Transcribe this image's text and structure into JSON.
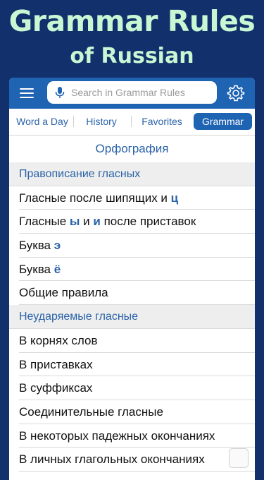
{
  "promo": {
    "title": "Grammar Rules",
    "subtitle": "of Russian"
  },
  "colors": {
    "background": "#12306b",
    "promo_text": "#c7f7d3",
    "navbar": "#1f63b3",
    "accent_text": "#2a63a8",
    "header_row": "#eeeeee"
  },
  "navbar": {
    "menu_icon": "hamburger-menu-icon",
    "mic_icon": "microphone-icon",
    "search_placeholder": "Search in Grammar Rules",
    "search_value": "",
    "settings_icon": "gear-icon"
  },
  "tabs": [
    {
      "label": "Word a Day",
      "active": false
    },
    {
      "label": "History",
      "active": false
    },
    {
      "label": "Favorites",
      "active": false
    },
    {
      "label": "Grammar",
      "active": true
    }
  ],
  "section_title": "Орфография",
  "rows": [
    {
      "type": "header",
      "parts": [
        {
          "t": "Правописание гласных"
        }
      ]
    },
    {
      "type": "item",
      "parts": [
        {
          "t": "Гласные после шипящих и "
        },
        {
          "t": "ц",
          "hl": true
        }
      ]
    },
    {
      "type": "item",
      "parts": [
        {
          "t": "Гласные "
        },
        {
          "t": "ы",
          "hl": true
        },
        {
          "t": " и "
        },
        {
          "t": "и",
          "hl": true
        },
        {
          "t": " после приставок"
        }
      ]
    },
    {
      "type": "item",
      "parts": [
        {
          "t": "Буква "
        },
        {
          "t": "э",
          "hl": true
        }
      ]
    },
    {
      "type": "item",
      "parts": [
        {
          "t": "Буква "
        },
        {
          "t": "ё",
          "hl": true
        }
      ]
    },
    {
      "type": "item",
      "parts": [
        {
          "t": "Общие правила"
        }
      ]
    },
    {
      "type": "header",
      "parts": [
        {
          "t": "Неударяемые гласные"
        }
      ]
    },
    {
      "type": "item",
      "parts": [
        {
          "t": "В корнях слов"
        }
      ]
    },
    {
      "type": "item",
      "parts": [
        {
          "t": "В приставках"
        }
      ]
    },
    {
      "type": "item",
      "parts": [
        {
          "t": "В суффиксах"
        }
      ]
    },
    {
      "type": "item",
      "parts": [
        {
          "t": "Соединительные гласные"
        }
      ]
    },
    {
      "type": "item",
      "parts": [
        {
          "t": "В некоторых падежных окончаниях"
        }
      ]
    },
    {
      "type": "item",
      "parts": [
        {
          "t": "В личных глагольных окончаниях"
        }
      ]
    }
  ]
}
